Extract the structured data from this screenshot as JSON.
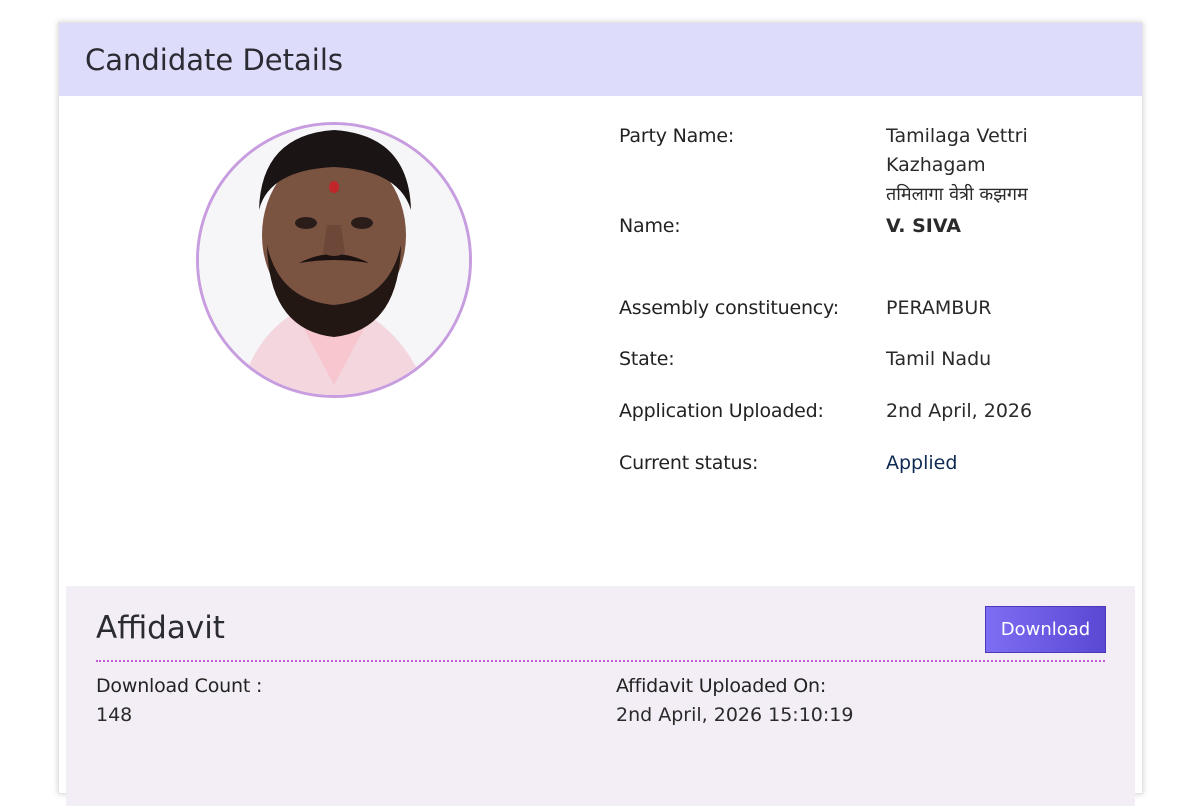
{
  "header": {
    "title": "Candidate Details"
  },
  "photo": {
    "alt": "Candidate photo"
  },
  "details": {
    "party": {
      "label": "Party Name:",
      "value_line1": "Tamilaga Vettri",
      "value_line2": "Kazhagam",
      "value_hindi": "तमिलागा वेत्री कझगम"
    },
    "name": {
      "label": "Name:",
      "value": "V. SIVA"
    },
    "constituency": {
      "label": "Assembly constituency:",
      "value": "PERAMBUR"
    },
    "state": {
      "label": "State:",
      "value": "Tamil Nadu"
    },
    "uploaded": {
      "label": "Application Uploaded:",
      "value": "2nd April, 2026"
    },
    "status": {
      "label": "Current status:",
      "value": "Applied"
    }
  },
  "affidavit": {
    "title": "Affidavit",
    "download_label": "Download",
    "download_count_label": "Download Count :",
    "download_count_value": "148",
    "uploaded_on_label": "Affidavit Uploaded On:",
    "uploaded_on_value": "2nd April, 2026 15:10:19"
  },
  "colors": {
    "header_bg": "#dedcfb",
    "affidavit_bg": "#f3eef6",
    "button_bg": "#6a59e3",
    "status_text": "#0d2a52",
    "photo_border": "#c79de0"
  }
}
